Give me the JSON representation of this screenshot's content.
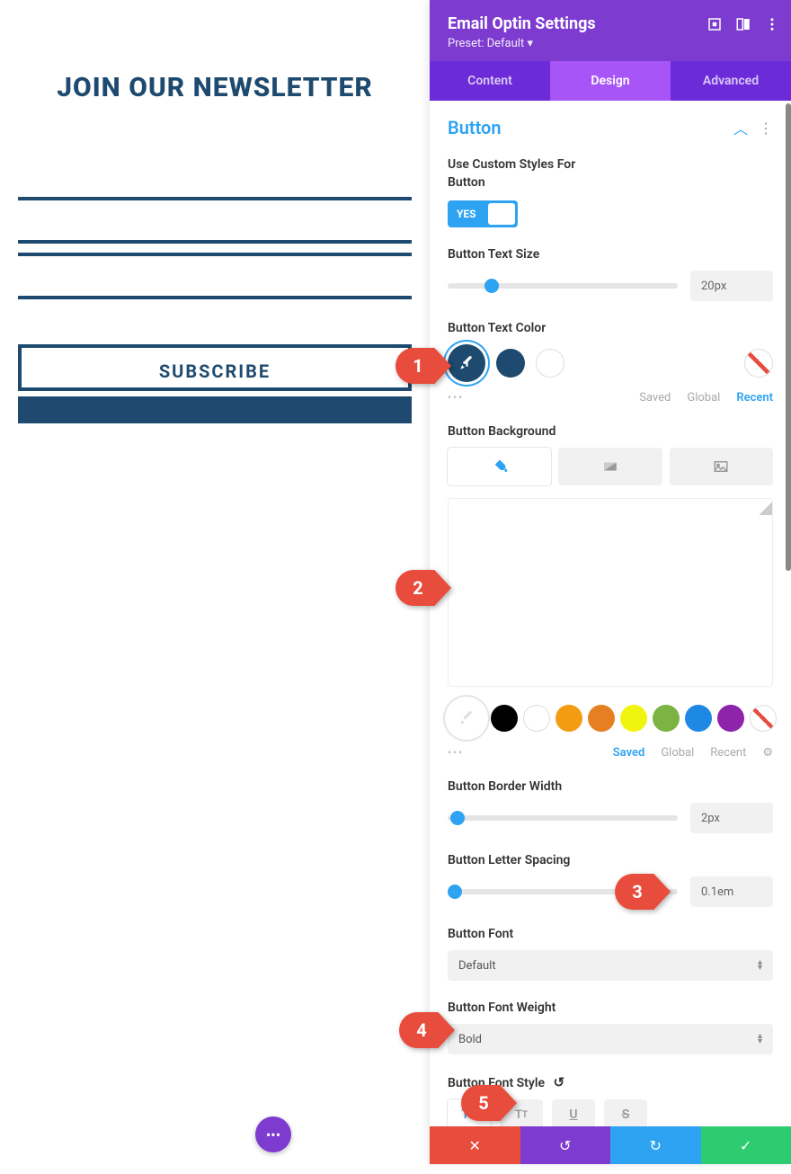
{
  "preview": {
    "newsletter_title": "JOIN OUR NEWSLETTER",
    "subscribe_label": "SUBSCRIBE"
  },
  "panel": {
    "title": "Email Optin Settings",
    "preset": "Preset: Default",
    "tabs": {
      "content": "Content",
      "design": "Design",
      "advanced": "Advanced"
    },
    "section_title": "Button",
    "fields": {
      "custom_styles_label": "Use Custom Styles For Button",
      "toggle_yes": "YES",
      "text_size_label": "Button Text Size",
      "text_size_value": "20px",
      "text_color_label": "Button Text Color",
      "color_tabs": {
        "saved": "Saved",
        "global": "Global",
        "recent": "Recent"
      },
      "background_label": "Button Background",
      "border_width_label": "Button Border Width",
      "border_width_value": "2px",
      "letter_spacing_label": "Button Letter Spacing",
      "letter_spacing_value": "0.1em",
      "font_label": "Button Font",
      "font_value": "Default",
      "font_weight_label": "Button Font Weight",
      "font_weight_value": "Bold",
      "font_style_label": "Button Font Style"
    }
  },
  "markers": {
    "m1": "1",
    "m2": "2",
    "m3": "3",
    "m4": "4",
    "m5": "5"
  }
}
